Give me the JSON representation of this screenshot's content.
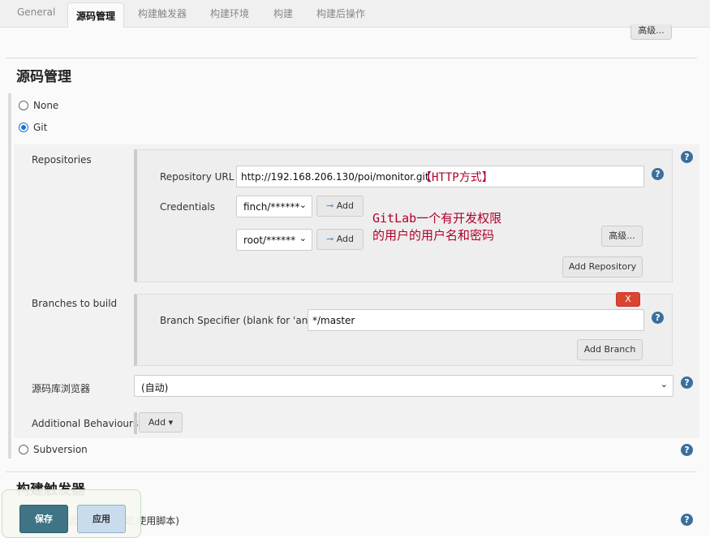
{
  "tabs": [
    {
      "label": "General"
    },
    {
      "label": "源码管理"
    },
    {
      "label": "构建触发器"
    },
    {
      "label": "构建环境"
    },
    {
      "label": "构建"
    },
    {
      "label": "构建后操作"
    }
  ],
  "top_advanced": "高级...",
  "scm": {
    "title": "源码管理",
    "none": "None",
    "git": "Git",
    "subversion": "Subversion",
    "repositories_label": "Repositories",
    "repo_url_label": "Repository URL",
    "repo_url": "http://192.168.206.130/poi/monitor.git",
    "repo_note": "【HTTP方式】",
    "credentials_label": "Credentials",
    "cred1": "finch/******",
    "cred2": "root/******",
    "add": "Add",
    "cred_note1": "GitLab一个有开发权限",
    "cred_note2": "的用户的用户名和密码",
    "advanced": "高级...",
    "add_repository": "Add Repository",
    "branches_label": "Branches to build",
    "delete": "X",
    "branch_spec_label": "Branch Specifier (blank for 'any')",
    "branch_spec": "*/master",
    "add_branch": "Add Branch",
    "browser_label": "源码库浏览器",
    "browser_value": "(自动)",
    "behaviours_label": "Additional Behaviours",
    "behaviours_add": "Add"
  },
  "triggers": {
    "title": "构建触发器",
    "remote": "触发远程构建 (例如,使用脚本)"
  },
  "footer": {
    "save": "保存",
    "apply": "应用"
  },
  "accent": "#3f7484"
}
